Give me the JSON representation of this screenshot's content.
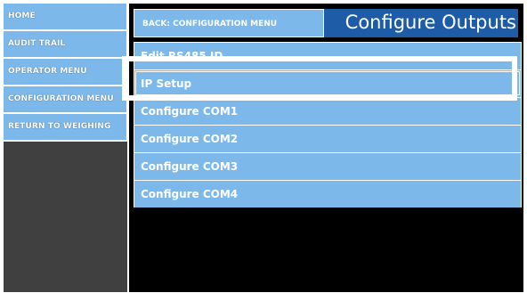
{
  "sidebar": {
    "items": [
      {
        "label": "HOME"
      },
      {
        "label": "AUDIT TRAIL"
      },
      {
        "label": "OPERATOR MENU"
      },
      {
        "label": "CONFIGURATION MENU"
      },
      {
        "label": "RETURN TO WEIGHING"
      }
    ]
  },
  "header": {
    "back_label": "BACK: CONFIGURATION MENU",
    "title": "Configure Outputs"
  },
  "menu": {
    "items": [
      {
        "label": "Edit RS485 ID"
      },
      {
        "label": "IP Setup"
      },
      {
        "label": "Configure COM1"
      },
      {
        "label": "Configure COM2"
      },
      {
        "label": "Configure COM3"
      },
      {
        "label": "Configure COM4"
      }
    ],
    "selected_label": "IP Setup"
  },
  "colors": {
    "button_blue": "#7db8ea",
    "title_blue": "#1f5ca8",
    "sidebar_bg": "#404040",
    "screen_bg": "#000000"
  }
}
